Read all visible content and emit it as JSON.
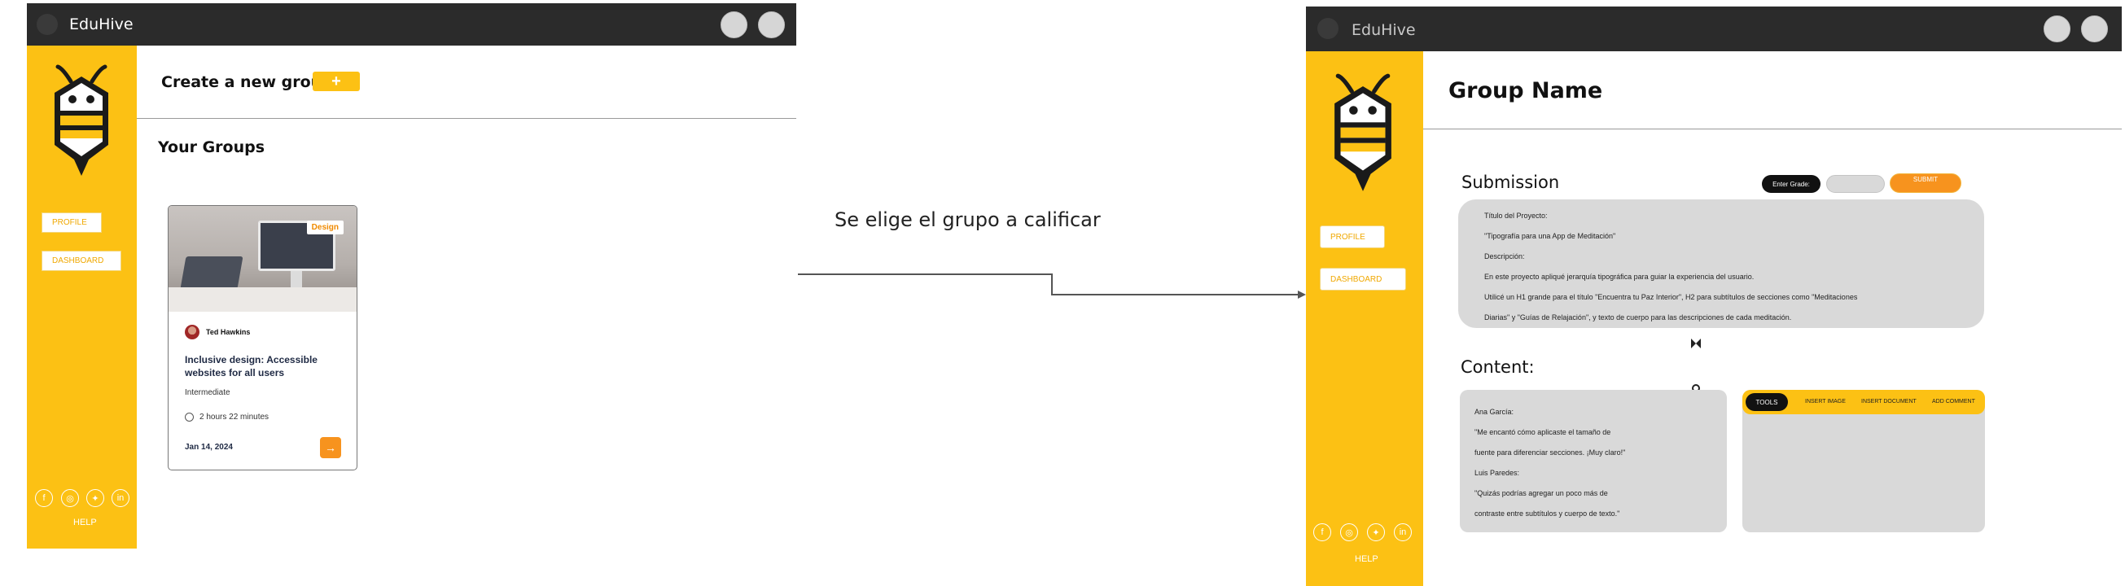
{
  "screen1": {
    "brand": "EduHive",
    "sidebar": {
      "profile": "PROFILE",
      "dashboard": "DASHBOARD",
      "help": "HELP"
    },
    "create_group_label": "Create a new group",
    "create_group_button": "+",
    "your_groups_heading": "Your Groups",
    "card": {
      "tag": "Design",
      "author": "Ted Hawkins",
      "title_line1": "Inclusive design: Accessible",
      "title_line2": "websites for all users",
      "level": "Intermediate",
      "duration": "2 hours 22 minutes",
      "date": "Jan 14, 2024",
      "arrow": "→"
    }
  },
  "annotation": "Se elige el grupo a calificar",
  "screen2": {
    "brand": "EduHive",
    "sidebar": {
      "profile": "PROFILE",
      "dashboard": "DASHBOARD",
      "help": "HELP"
    },
    "group_name": "Group Name",
    "submission_heading": "Submission",
    "enter_grade_label": "Enter Grade:",
    "submit_label": "SUBMIT",
    "submission_text": {
      "line1": "Título del Proyecto:",
      "line2": "\"Tipografía para una App de Meditación\"",
      "line3": "Descripción:",
      "line4": "En este proyecto apliqué jerarquía tipográfica para guiar la experiencia del usuario.",
      "line5": "Utilicé un H1 grande para el título \"Encuentra tu Paz Interior\", H2 para subtítulos de secciones como \"Meditaciones",
      "line6": "Diarias\" y \"Guías de Relajación\", y texto de cuerpo para las descripciones de cada meditación."
    },
    "content_heading": "Content:",
    "comments": {
      "line1": "Ana García:",
      "line2": "\"Me encantó cómo aplicaste el tamaño de",
      "line3": "fuente para diferenciar secciones. ¡Muy claro!\"",
      "line4": "Luis Paredes:",
      "line5": "\"Quizás podrías agregar un poco más de",
      "line6": "contraste entre subtítulos y cuerpo de texto.\""
    },
    "toolbar": {
      "tools": "TOOLS",
      "insert_image": "INSERT IMAGE",
      "insert_document": "INSERT DOCUMENT",
      "add_comment": "ADD COMMENT"
    }
  },
  "colors": {
    "accent": "#fcc114",
    "topbar": "#2b2b2b",
    "orange": "#f7931e"
  }
}
